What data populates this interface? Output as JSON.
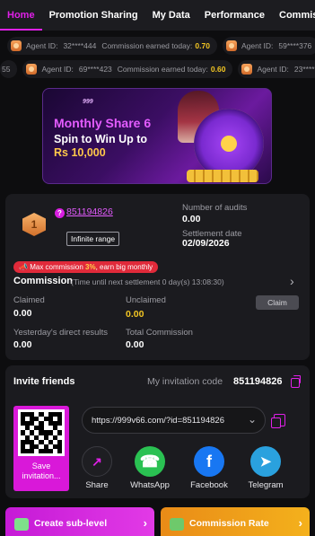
{
  "tabs": [
    {
      "label": "Home",
      "active": true
    },
    {
      "label": "Promotion Sharing",
      "active": false
    },
    {
      "label": "My Data",
      "active": false
    },
    {
      "label": "Performance",
      "active": false
    },
    {
      "label": "Commission",
      "active": false
    }
  ],
  "ticker": {
    "row1": [
      {
        "id_label": "Agent ID:",
        "agent_id": "32****444",
        "text": "Commission earned today:",
        "amount": "0.70"
      },
      {
        "id_label": "Agent ID:",
        "agent_id": "59****376",
        "text": "",
        "amount": ""
      }
    ],
    "row2": [
      {
        "lead": "55",
        "id_label": "",
        "agent_id": "",
        "text": "",
        "amount": ""
      },
      {
        "id_label": "Agent ID:",
        "agent_id": "69****423",
        "text": "Commission earned today:",
        "amount": "0.60"
      },
      {
        "id_label": "Agent ID:",
        "agent_id": "23****",
        "text": "",
        "amount": ""
      }
    ]
  },
  "banner": {
    "logo": "999",
    "title": "Monthly Share 6",
    "subtitle": "Spin to Win Up to",
    "amount": "Rs 10,000"
  },
  "agent": {
    "rank": "1",
    "help": "?",
    "id": "851194826",
    "range_tag": "Infinite range",
    "audits_label": "Number of audits",
    "audits_value": "0.00",
    "settlement_label": "Settlement date",
    "settlement_value": "02/09/2026",
    "promo_prefix": "Max commission ",
    "promo_pct": "3%",
    "promo_suffix": ", earn big monthly",
    "commission_title": "Commission",
    "commission_sub": "(Time until next settlement  0 day(s) 13:08:30)",
    "claimed_label": "Claimed",
    "claimed_value": "0.00",
    "unclaimed_label": "Unclaimed",
    "unclaimed_value": "0.00",
    "claim_button": "Claim",
    "yesterday_label": "Yesterday's direct results",
    "yesterday_value": "0.00",
    "total_label": "Total Commission",
    "total_value": "0.00"
  },
  "invite": {
    "title": "Invite friends",
    "code_label": "My invitation code",
    "code": "851194826",
    "save_label": "Save invitation...",
    "link": "https://999v66.com/?id=851194826",
    "share_items": [
      {
        "label": "Share",
        "icon": "share-icon",
        "color": "#1e1e22"
      },
      {
        "label": "WhatsApp",
        "icon": "whatsapp-icon",
        "color": "#2ac152"
      },
      {
        "label": "Facebook",
        "icon": "facebook-icon",
        "color": "#1877f2"
      },
      {
        "label": "Telegram",
        "icon": "telegram-icon",
        "color": "#2aa1de"
      }
    ]
  },
  "bottom": {
    "left_label": "Create sub-level",
    "right_label": "Commission Rate"
  },
  "colors": {
    "accent": "#e020e8",
    "gold": "#f3c623",
    "card": "#1b1b1f",
    "background": "#0d0d0f"
  }
}
